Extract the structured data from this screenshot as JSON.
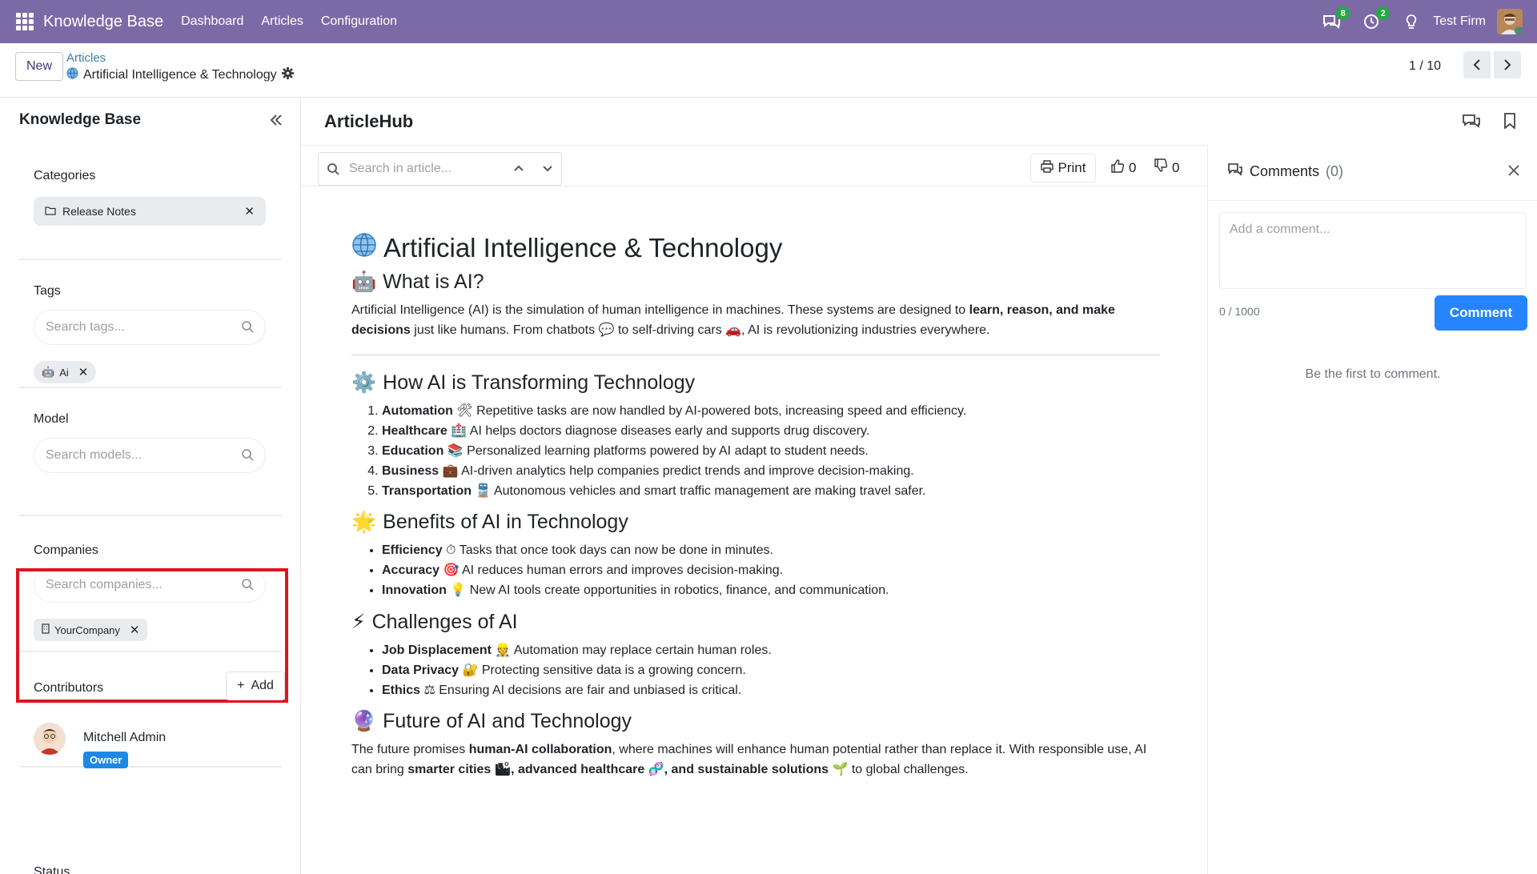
{
  "topbar": {
    "brand": "Knowledge Base",
    "menu": [
      "Dashboard",
      "Articles",
      "Configuration"
    ],
    "messages_count": "8",
    "activities_count": "2",
    "user": "Test Firm"
  },
  "control": {
    "new_label": "New",
    "breadcrumb_parent": "Articles",
    "breadcrumb_current": "Artificial Intelligence & Technology",
    "pager": "1 / 10"
  },
  "sidebar": {
    "title": "Knowledge Base",
    "categories_label": "Categories",
    "category_chip": "Release Notes",
    "tags_label": "Tags",
    "tags_placeholder": "Search tags...",
    "tag_chip": "Ai",
    "model_label": "Model",
    "model_placeholder": "Search models...",
    "companies_label": "Companies",
    "companies_placeholder": "Search companies...",
    "company_chip": "YourCompany",
    "contributors_label": "Contributors",
    "add_label": "Add",
    "contributor_name": "Mitchell Admin",
    "contributor_role": "Owner",
    "status_label": "Status"
  },
  "main": {
    "title": "ArticleHub",
    "search_placeholder": "Search in article...",
    "print_label": "Print",
    "likes": "0",
    "dislikes": "0"
  },
  "article": {
    "h1": "Artificial Intelligence & Technology",
    "s1_title": "What is AI?",
    "s1_p_a": "Artificial Intelligence (AI) is the simulation of human intelligence in machines. These systems are designed to ",
    "s1_p_b": "learn, reason, and make decisions",
    "s1_p_c": " just like humans. From chatbots 💬 to self-driving cars 🚗, AI is revolutionizing industries everywhere.",
    "s2_title": "How AI is Transforming Technology",
    "s2_items": [
      {
        "b": "Automation",
        "e": "🛠",
        "t": " Repetitive tasks are now handled by AI-powered bots, increasing speed and efficiency."
      },
      {
        "b": "Healthcare",
        "e": "🏥",
        "t": " AI helps doctors diagnose diseases early and supports drug discovery."
      },
      {
        "b": "Education",
        "e": "📚",
        "t": " Personalized learning platforms powered by AI adapt to student needs."
      },
      {
        "b": "Business",
        "e": "💼",
        "t": " AI-driven analytics help companies predict trends and improve decision-making."
      },
      {
        "b": "Transportation",
        "e": "🚆",
        "t": " Autonomous vehicles and smart traffic management are making travel safer."
      }
    ],
    "s3_title": "Benefits of AI in Technology",
    "s3_items": [
      {
        "b": "Efficiency",
        "e": "⏱",
        "t": " Tasks that once took days can now be done in minutes."
      },
      {
        "b": "Accuracy",
        "e": "🎯",
        "t": " AI reduces human errors and improves decision-making."
      },
      {
        "b": "Innovation",
        "e": "💡",
        "t": " New AI tools create opportunities in robotics, finance, and communication."
      }
    ],
    "s4_title": "Challenges of AI",
    "s4_items": [
      {
        "b": "Job Displacement",
        "e": "👷",
        "t": " Automation may replace certain human roles."
      },
      {
        "b": "Data Privacy",
        "e": "🔐",
        "t": " Protecting sensitive data is a growing concern."
      },
      {
        "b": "Ethics",
        "e": "⚖",
        "t": " Ensuring AI decisions are fair and unbiased is critical."
      }
    ],
    "s5_title": "Future of AI and Technology",
    "s5_p_a": "The future promises ",
    "s5_p_b": "human-AI collaboration",
    "s5_p_c": ", where machines will enhance human potential rather than replace it. With responsible use, AI can bring ",
    "s5_p_d": "smarter cities 🏙, advanced healthcare 🧬, and sustainable solutions 🌱",
    "s5_p_e": " to global challenges."
  },
  "comments": {
    "title": "Comments",
    "count": "(0)",
    "placeholder": "Add a comment...",
    "char_count": "0 / 1000",
    "submit_label": "Comment",
    "empty_text": "Be the first to comment."
  },
  "colors": {
    "topbar": "#7c6aa6",
    "highlight": "#e0141e",
    "primary_button": "#2684ff",
    "owner_badge": "#1e88e5"
  }
}
